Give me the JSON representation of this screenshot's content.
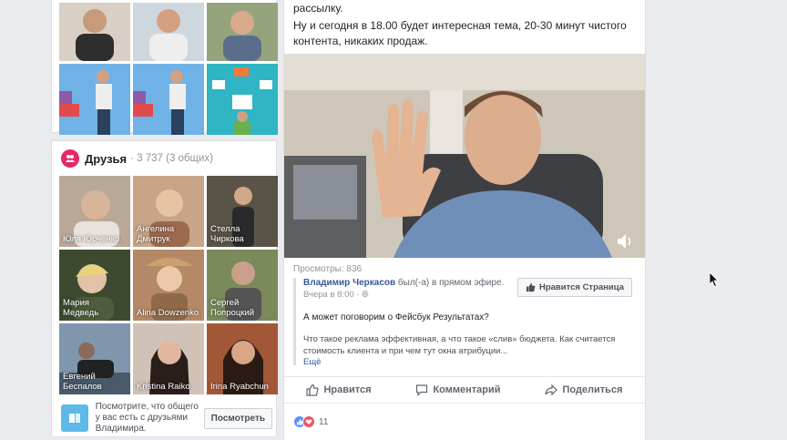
{
  "friends": {
    "title": "Друзья",
    "meta": "· 3 737 (3 общих)",
    "tiles": [
      {
        "name": "Юля Юрченко",
        "bg": "#b9a898"
      },
      {
        "name": "Ангелина\nДмитрук",
        "bg": "#c8a488"
      },
      {
        "name": "Стелла\nЧиркова",
        "bg": "#5a5448"
      },
      {
        "name": "Мария\nМедведь",
        "bg": "#3d4a2f"
      },
      {
        "name": "Alina Dowzenko",
        "bg": "#b58966"
      },
      {
        "name": "Сергей\nПопроцкий",
        "bg": "#7b8a5a"
      },
      {
        "name": "Евгений\nБеспалов",
        "bg": "#7f96ad"
      },
      {
        "name": "Kristina Raiko",
        "bg": "#d1c2b8"
      },
      {
        "name": "Irina Ryabchun",
        "bg": "#a25737"
      }
    ],
    "see_text": "Посмотрите, что общего у вас есть с друзьями Владимира.",
    "see_button": "Посмотреть"
  },
  "post": {
    "text_line1": "рассылку.",
    "text_line2": "Ну и сегодня в 18.00 будет интересная тема, 20-30 минут чистого контента, никаких продаж.",
    "views": "Просмотры: 836",
    "shared": {
      "author": "Владимир Черкасов",
      "status": " был(-а) в прямом эфире.",
      "time": "Вчера в 8:00 · ",
      "like_page_button": "Нравится Страница",
      "question": "А может поговорим о Фейсбук Результатах?",
      "description": "Что такое реклама эффективная, а что такое «слив» бюджета. Как считается стоимость клиента и при чем тут окна атрибуции...",
      "more": "Ещё"
    },
    "actions": {
      "like": "Нравится",
      "comment": "Комментарий",
      "share": "Поделиться"
    },
    "reactions_count": "11"
  },
  "colors": {
    "accent": "#365899",
    "friends_icon": "#e5276b",
    "page_bg": "#e9ebee"
  }
}
